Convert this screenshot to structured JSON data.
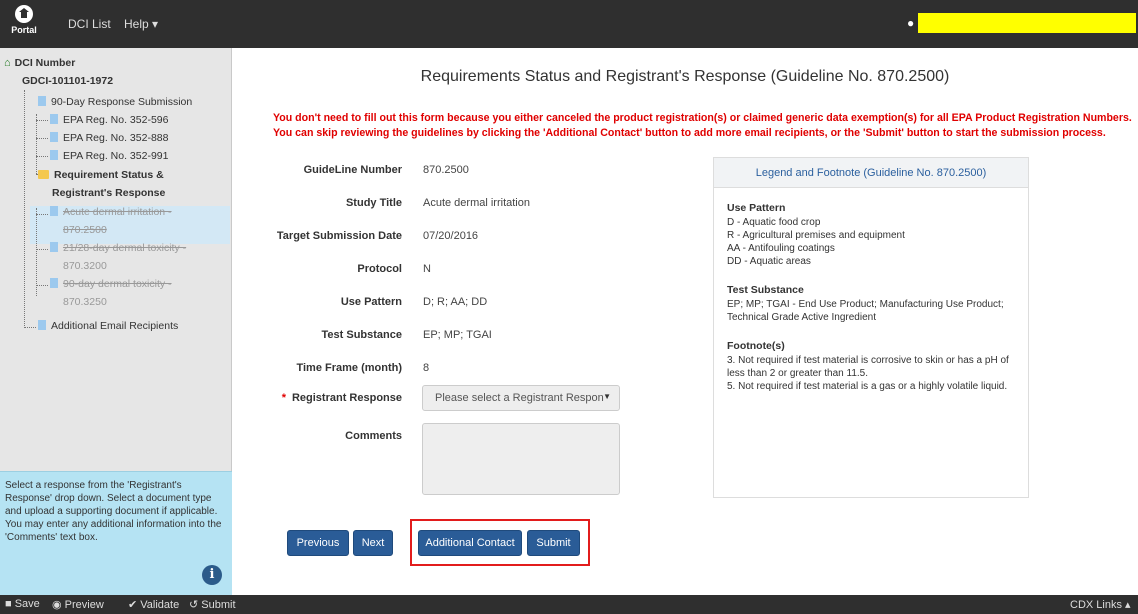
{
  "navbar": {
    "logo_text": "Portal",
    "dci_list": "DCI List",
    "help": "Help ▾"
  },
  "sidebar": {
    "root_label": "DCI Number",
    "dci_id": "GDCI-101101-1972",
    "response_submission": "90-Day Response Submission",
    "reg_1": "EPA Reg. No. 352-596",
    "reg_2": "EPA Reg. No. 352-888",
    "reg_3": "EPA Reg. No. 352-991",
    "status_line1": "Requirement Status &",
    "status_line2": "Registrant's Response",
    "g1_line1": "Acute dermal irritation -",
    "g1_line2": "870.2500",
    "g2_line1": "21/28-day dermal toxicity -",
    "g2_line2": "870.3200",
    "g3_line1": "90-day dermal toxicity -",
    "g3_line2": "870.3250",
    "additional_email": "Additional Email Recipients",
    "help_text": "Select a response from the 'Registrant's Response' drop down. Select a document type and upload a supporting document if applicable. You may enter any additional information into the 'Comments' text box.",
    "info_glyph": "i"
  },
  "main": {
    "title": "Requirements Status and Registrant's Response (Guideline No. 870.2500)",
    "warning_line1": "You don't need to fill out this form because you either canceled the product registration(s) or claimed generic data exemption(s) for all EPA Product Registration Numbers.",
    "warning_line2": "You can skip reviewing the guidelines by clicking the 'Additional Contact' button to add more email recipients, or the 'Submit' button to start the submission process.",
    "fields": {
      "guideline_label": "GuideLine Number",
      "guideline_value": "870.2500",
      "study_label": "Study Title",
      "study_value": "Acute dermal irritation",
      "target_label": "Target Submission Date",
      "target_value": "07/20/2016",
      "protocol_label": "Protocol",
      "protocol_value": "N",
      "use_label": "Use Pattern",
      "use_value": "D; R; AA; DD",
      "substance_label": "Test Substance",
      "substance_value": "EP; MP; TGAI",
      "timeframe_label": "Time Frame (month)",
      "timeframe_value": "8",
      "response_label": "Registrant Response",
      "response_star": "*",
      "response_placeholder": "Please select a Registrant Respon",
      "comments_label": "Comments"
    },
    "legend": {
      "title": "Legend and Footnote (Guideline No. 870.2500)",
      "use_heading": "Use Pattern",
      "use_1": "D - Aquatic food crop",
      "use_2": "R - Agricultural premises and equipment",
      "use_3": "AA - Antifouling coatings",
      "use_4": "DD - Aquatic areas",
      "sub_heading": "Test Substance",
      "sub_1": "EP; MP; TGAI - End Use Product; Manufacturing Use Product; Technical Grade Active Ingredient",
      "foot_heading": "Footnote(s)",
      "foot_1": "3. Not required if test material is corrosive to skin or has a pH of less than 2 or greater than 11.5.",
      "foot_2": "5. Not required if test material is a gas or a highly volatile liquid."
    },
    "buttons": {
      "previous": "Previous",
      "next": "Next",
      "additional_contact": "Additional Contact",
      "submit": "Submit"
    }
  },
  "bottombar": {
    "save": "Save",
    "preview": "Preview",
    "validate": "Validate",
    "submit": "Submit",
    "cdx_links": "CDX Links ▴"
  }
}
